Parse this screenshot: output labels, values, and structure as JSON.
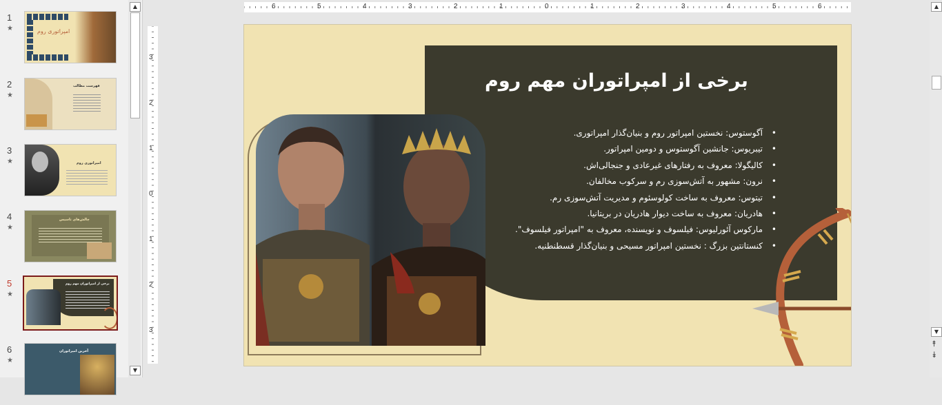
{
  "app": {
    "window": "PowerPoint slide editor"
  },
  "thumbnails": [
    {
      "number": "1",
      "star": "★",
      "title": "امپراتوری روم"
    },
    {
      "number": "2",
      "star": "★",
      "title": "فهرست مطالب"
    },
    {
      "number": "3",
      "star": "★",
      "title": "امپراتوری روم"
    },
    {
      "number": "4",
      "star": "★",
      "title": "چالش‌های تاسیس"
    },
    {
      "number": "5",
      "star": "★",
      "title": "برخی از امپراتوران مهم روم"
    },
    {
      "number": "6",
      "star": "★",
      "title": "آخرین امپراتوران"
    }
  ],
  "ruler": {
    "horizontal_ticks": [
      "6",
      "5",
      "4",
      "3",
      "2",
      "1",
      "0",
      "1",
      "2",
      "3",
      "4",
      "5",
      "6"
    ],
    "vertical_ticks": [
      "3",
      "2",
      "1",
      "0",
      "1",
      "2",
      "3"
    ]
  },
  "slide": {
    "title": "برخی از امپراتوران مهم روم",
    "bullets": [
      "آگوستوس: نخستین امپراتور روم و بنیان‌گذار امپراتوری.",
      "تیبریوس: جانشین آگوستوس و دومین امپراتور.",
      "کالیگولا: معروف به رفتارهای غیرعادی و جنجالی‌اش.",
      "نرون: مشهور به آتش‌سوزی رم و سرکوب مخالفان.",
      "تیتوس: معروف به ساخت کولوسئوم و مدیریت آتش‌سوزی رم.",
      "هادریان: معروف به ساخت دیوار هادریان در بریتانیا.",
      "مارکوس آئورلیوس: فیلسوف و نویسنده، معروف به \"امپراتور فیلسوف\".",
      "کنستانتین بزرگ : نخستین امپراتور مسیحی و بنیان‌گذار قسطنطنیه."
    ],
    "colors": {
      "background": "#f1e3b2",
      "panel": "#3b3a2d",
      "title": "#ffffff",
      "frame": "#8c7a5a"
    }
  },
  "icons": {
    "scroll_up": "▲",
    "scroll_down": "▼",
    "prev_slide": "⯭",
    "next_slide": "⯯"
  }
}
